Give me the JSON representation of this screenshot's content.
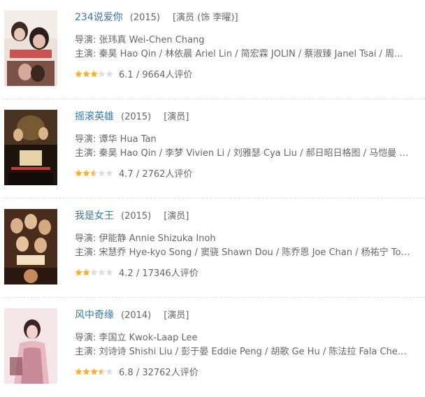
{
  "movies": [
    {
      "title": "234说爱你",
      "year": "(2015)",
      "role": "[演员 (饰 李曜)]",
      "director_prefix": "导演: ",
      "director": "张玮真 Wei-Chen Chang",
      "cast_prefix": "主演: ",
      "cast": "秦昊 Hao Qin / 林依晨 Ariel Lin / 简宏霖 JOLIN / 蔡淑臻 Janel Tsai / 周...",
      "rating_value": 3.0,
      "score": "6.1",
      "votes": "9664人评价",
      "poster_colors": [
        "#f0e6df",
        "#c9a79a",
        "#7d5246",
        "#e7d2c6"
      ]
    },
    {
      "title": "摇滚英雄",
      "year": "(2015)",
      "role": "[演员]",
      "director_prefix": "导演: ",
      "director": "谭华 Hua Tan",
      "cast_prefix": "主演: ",
      "cast": "秦昊 Hao Qin / 李梦 Vivien Li / 刘雅瑟 Cya Liu / 郝日昭日格图 / 马恺曼 K...",
      "rating_value": 2.5,
      "score": "4.7",
      "votes": "2762人评价",
      "poster_colors": [
        "#2a1c14",
        "#6b4a2a",
        "#d9c29a",
        "#8a2a1e"
      ]
    },
    {
      "title": "我是女王",
      "year": "(2015)",
      "role": "[演员]",
      "director_prefix": "导演: ",
      "director": "伊能静 Annie Shizuka Inoh",
      "cast_prefix": "主演: ",
      "cast": "宋慧乔 Hye-kyo Song / 窦骁 Shawn Dou / 陈乔恩 Joe Chan / 杨祐宁 Tony Yan...",
      "rating_value": 2.0,
      "score": "4.2",
      "votes": "17346人评价",
      "poster_colors": [
        "#3a2418",
        "#a86a3a",
        "#e9c79a",
        "#c43a3a"
      ]
    },
    {
      "title": "风中奇缘",
      "year": "(2014)",
      "role": "[演员]",
      "director_prefix": "导演: ",
      "director": "李国立 Kwok-Laap Lee",
      "cast_prefix": "主演: ",
      "cast": "刘诗诗 Shishi Liu / 彭于晏 Eddie Peng / 胡歌 Ge Hu / 陈法拉 Fala Chen / ...",
      "rating_value": 3.5,
      "score": "6.8",
      "votes": "32762人评价",
      "poster_colors": [
        "#f4e4e6",
        "#e6bfc6",
        "#b27a86",
        "#8a4a56"
      ]
    }
  ],
  "colors": {
    "link": "#3377aa",
    "text": "#666666",
    "star_on": "#ffac2d",
    "star_off": "#dddddd",
    "separator": "#dddddd"
  }
}
